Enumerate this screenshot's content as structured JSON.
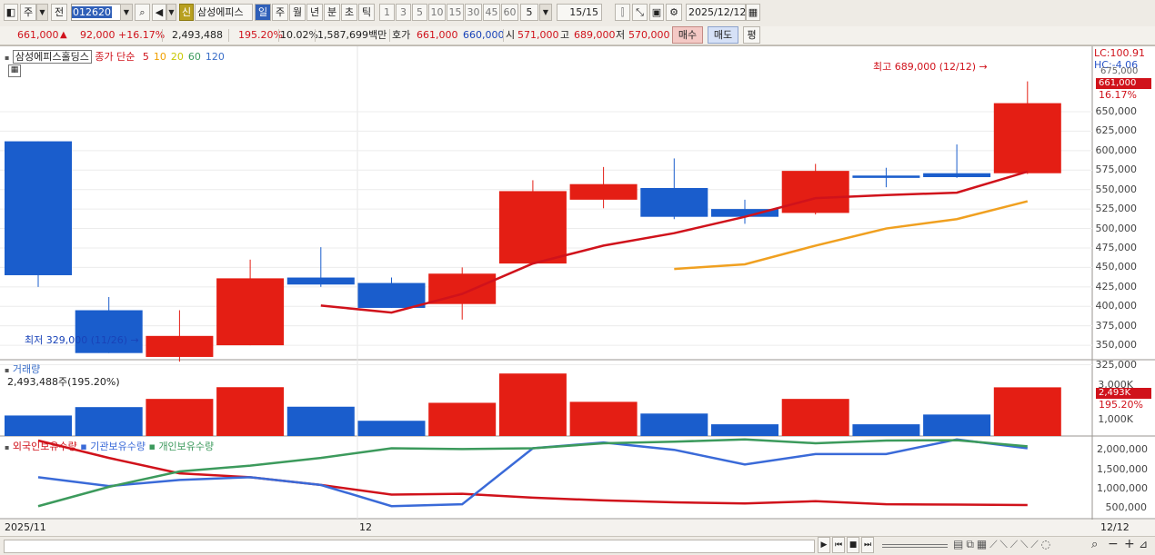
{
  "toolbar": {
    "period_main": "주",
    "prev": "전",
    "code": "012620",
    "new_badge": "신",
    "name": "삼성에피스",
    "periods": [
      "일",
      "주",
      "월",
      "년",
      "분",
      "초",
      "틱"
    ],
    "active_period": "일",
    "numbers": [
      "1",
      "3",
      "5",
      "10",
      "15",
      "30",
      "45",
      "60"
    ],
    "count_value": "5",
    "page": "15/15",
    "date": "2025/12/12"
  },
  "info": {
    "price": "661,000",
    "change_arrow": "▲",
    "change": "92,000",
    "change_pct": "+16.17%",
    "volume": "2,493,488",
    "vol_ratio": "195.20%",
    "turnover": "10.02%",
    "amount": "1,587,699백만",
    "quote_label": "호가",
    "bid": "661,000",
    "ask": "660,000",
    "open_label": "시",
    "open": "571,000",
    "high_label": "고",
    "high": "689,000",
    "low_label": "저",
    "low": "570,000",
    "buy": "매수",
    "sell": "매도",
    "avg": "평"
  },
  "price_panel": {
    "stock_name": "삼성에피스홀딩스",
    "ma_label": "종가 단순",
    "ma_periods": [
      "5",
      "10",
      "20",
      "60",
      "120"
    ],
    "ma_colors": [
      "#d0121b",
      "#f0a000",
      "#c8c800",
      "#3c9a5c",
      "#3a6ec8"
    ],
    "high_marker": "최고 689,000 (12/12)",
    "low_marker": "최저 329,000 (11/26)",
    "lc": "LC:100.91",
    "hc": "HC:-4.06",
    "axis_top_partial": "675,000",
    "current_tag": "661,000",
    "current_pct": "16.17%",
    "y_ticks": [
      "650,000",
      "625,000",
      "600,000",
      "575,000",
      "550,000",
      "525,000",
      "500,000",
      "475,000",
      "450,000",
      "425,000",
      "400,000",
      "375,000",
      "350,000",
      "325,000"
    ]
  },
  "volume_panel": {
    "title": "거래량",
    "subtitle": "2,493,488주(195.20%)",
    "y_ticks": [
      "3,000K",
      "1,000K"
    ],
    "current_tag": "2,493K",
    "current_pct": "195.20%"
  },
  "holding_panel": {
    "legend": [
      "외국인보유수량",
      "기관보유수량",
      "개인보유수량"
    ],
    "legend_colors": [
      "#d0121b",
      "#3a6ad8",
      "#3c9a5c"
    ],
    "y_ticks": [
      "2,000,000",
      "1,500,000",
      "1,000,000",
      "500,000"
    ]
  },
  "x_axis": {
    "labels": [
      "2025/11",
      "12"
    ],
    "last_date": "12/12"
  },
  "chart_data": {
    "type": "candlestick",
    "candles": [
      {
        "o": 612000,
        "h": 612000,
        "l": 425000,
        "c": 440000,
        "color": "blue"
      },
      {
        "o": 395000,
        "h": 412000,
        "l": 340000,
        "c": 340000,
        "color": "blue"
      },
      {
        "o": 335000,
        "h": 395000,
        "l": 329000,
        "c": 362000,
        "color": "red"
      },
      {
        "o": 350000,
        "h": 460000,
        "l": 350000,
        "c": 436000,
        "color": "red"
      },
      {
        "o": 437000,
        "h": 476000,
        "l": 425000,
        "c": 428000,
        "color": "blue"
      },
      {
        "o": 430000,
        "h": 437000,
        "l": 398000,
        "c": 398000,
        "color": "blue"
      },
      {
        "o": 403000,
        "h": 450000,
        "l": 383000,
        "c": 442000,
        "color": "red"
      },
      {
        "o": 455000,
        "h": 562000,
        "l": 455000,
        "c": 548000,
        "color": "red"
      },
      {
        "o": 537000,
        "h": 579000,
        "l": 526000,
        "c": 557000,
        "color": "red"
      },
      {
        "o": 552000,
        "h": 590000,
        "l": 512000,
        "c": 515000,
        "color": "blue"
      },
      {
        "o": 525000,
        "h": 537000,
        "l": 506000,
        "c": 515000,
        "color": "blue"
      },
      {
        "o": 520000,
        "h": 583000,
        "l": 518000,
        "c": 574000,
        "color": "red"
      },
      {
        "o": 568000,
        "h": 578000,
        "l": 553000,
        "c": 565000,
        "color": "blue"
      },
      {
        "o": 571000,
        "h": 608000,
        "l": 565000,
        "c": 566000,
        "color": "blue"
      },
      {
        "o": 571000,
        "h": 689000,
        "l": 570000,
        "c": 661000,
        "color": "red"
      }
    ],
    "ma5": [
      null,
      null,
      null,
      null,
      401000,
      392000,
      416000,
      455000,
      478000,
      494000,
      515000,
      539000,
      543000,
      546000,
      573000
    ],
    "ma10": [
      null,
      null,
      null,
      null,
      null,
      null,
      null,
      null,
      null,
      448000,
      454000,
      478000,
      500000,
      512000,
      535000
    ],
    "volume": [
      {
        "v": 1050,
        "color": "blue"
      },
      {
        "v": 1480,
        "color": "blue"
      },
      {
        "v": 1900,
        "color": "red"
      },
      {
        "v": 2500,
        "color": "red"
      },
      {
        "v": 1500,
        "color": "blue"
      },
      {
        "v": 780,
        "color": "blue"
      },
      {
        "v": 1700,
        "color": "red"
      },
      {
        "v": 3200,
        "color": "red"
      },
      {
        "v": 1750,
        "color": "red"
      },
      {
        "v": 1150,
        "color": "blue"
      },
      {
        "v": 600,
        "color": "blue"
      },
      {
        "v": 1900,
        "color": "red"
      },
      {
        "v": 600,
        "color": "blue"
      },
      {
        "v": 1100,
        "color": "blue"
      },
      {
        "v": 2493,
        "color": "red"
      }
    ],
    "foreign": [
      2000000,
      1550000,
      1150000,
      1050000,
      850000,
      600000,
      620000,
      520000,
      450000,
      400000,
      370000,
      430000,
      350000,
      340000,
      330000
    ],
    "institution": [
      1050000,
      820000,
      980000,
      1050000,
      850000,
      300000,
      350000,
      1800000,
      1950000,
      1760000,
      1380000,
      1650000,
      1650000,
      2030000,
      1800000
    ],
    "individual": [
      300000,
      800000,
      1200000,
      1350000,
      1550000,
      1800000,
      1780000,
      1800000,
      1930000,
      1970000,
      2030000,
      1930000,
      2000000,
      2010000,
      1850000
    ]
  }
}
